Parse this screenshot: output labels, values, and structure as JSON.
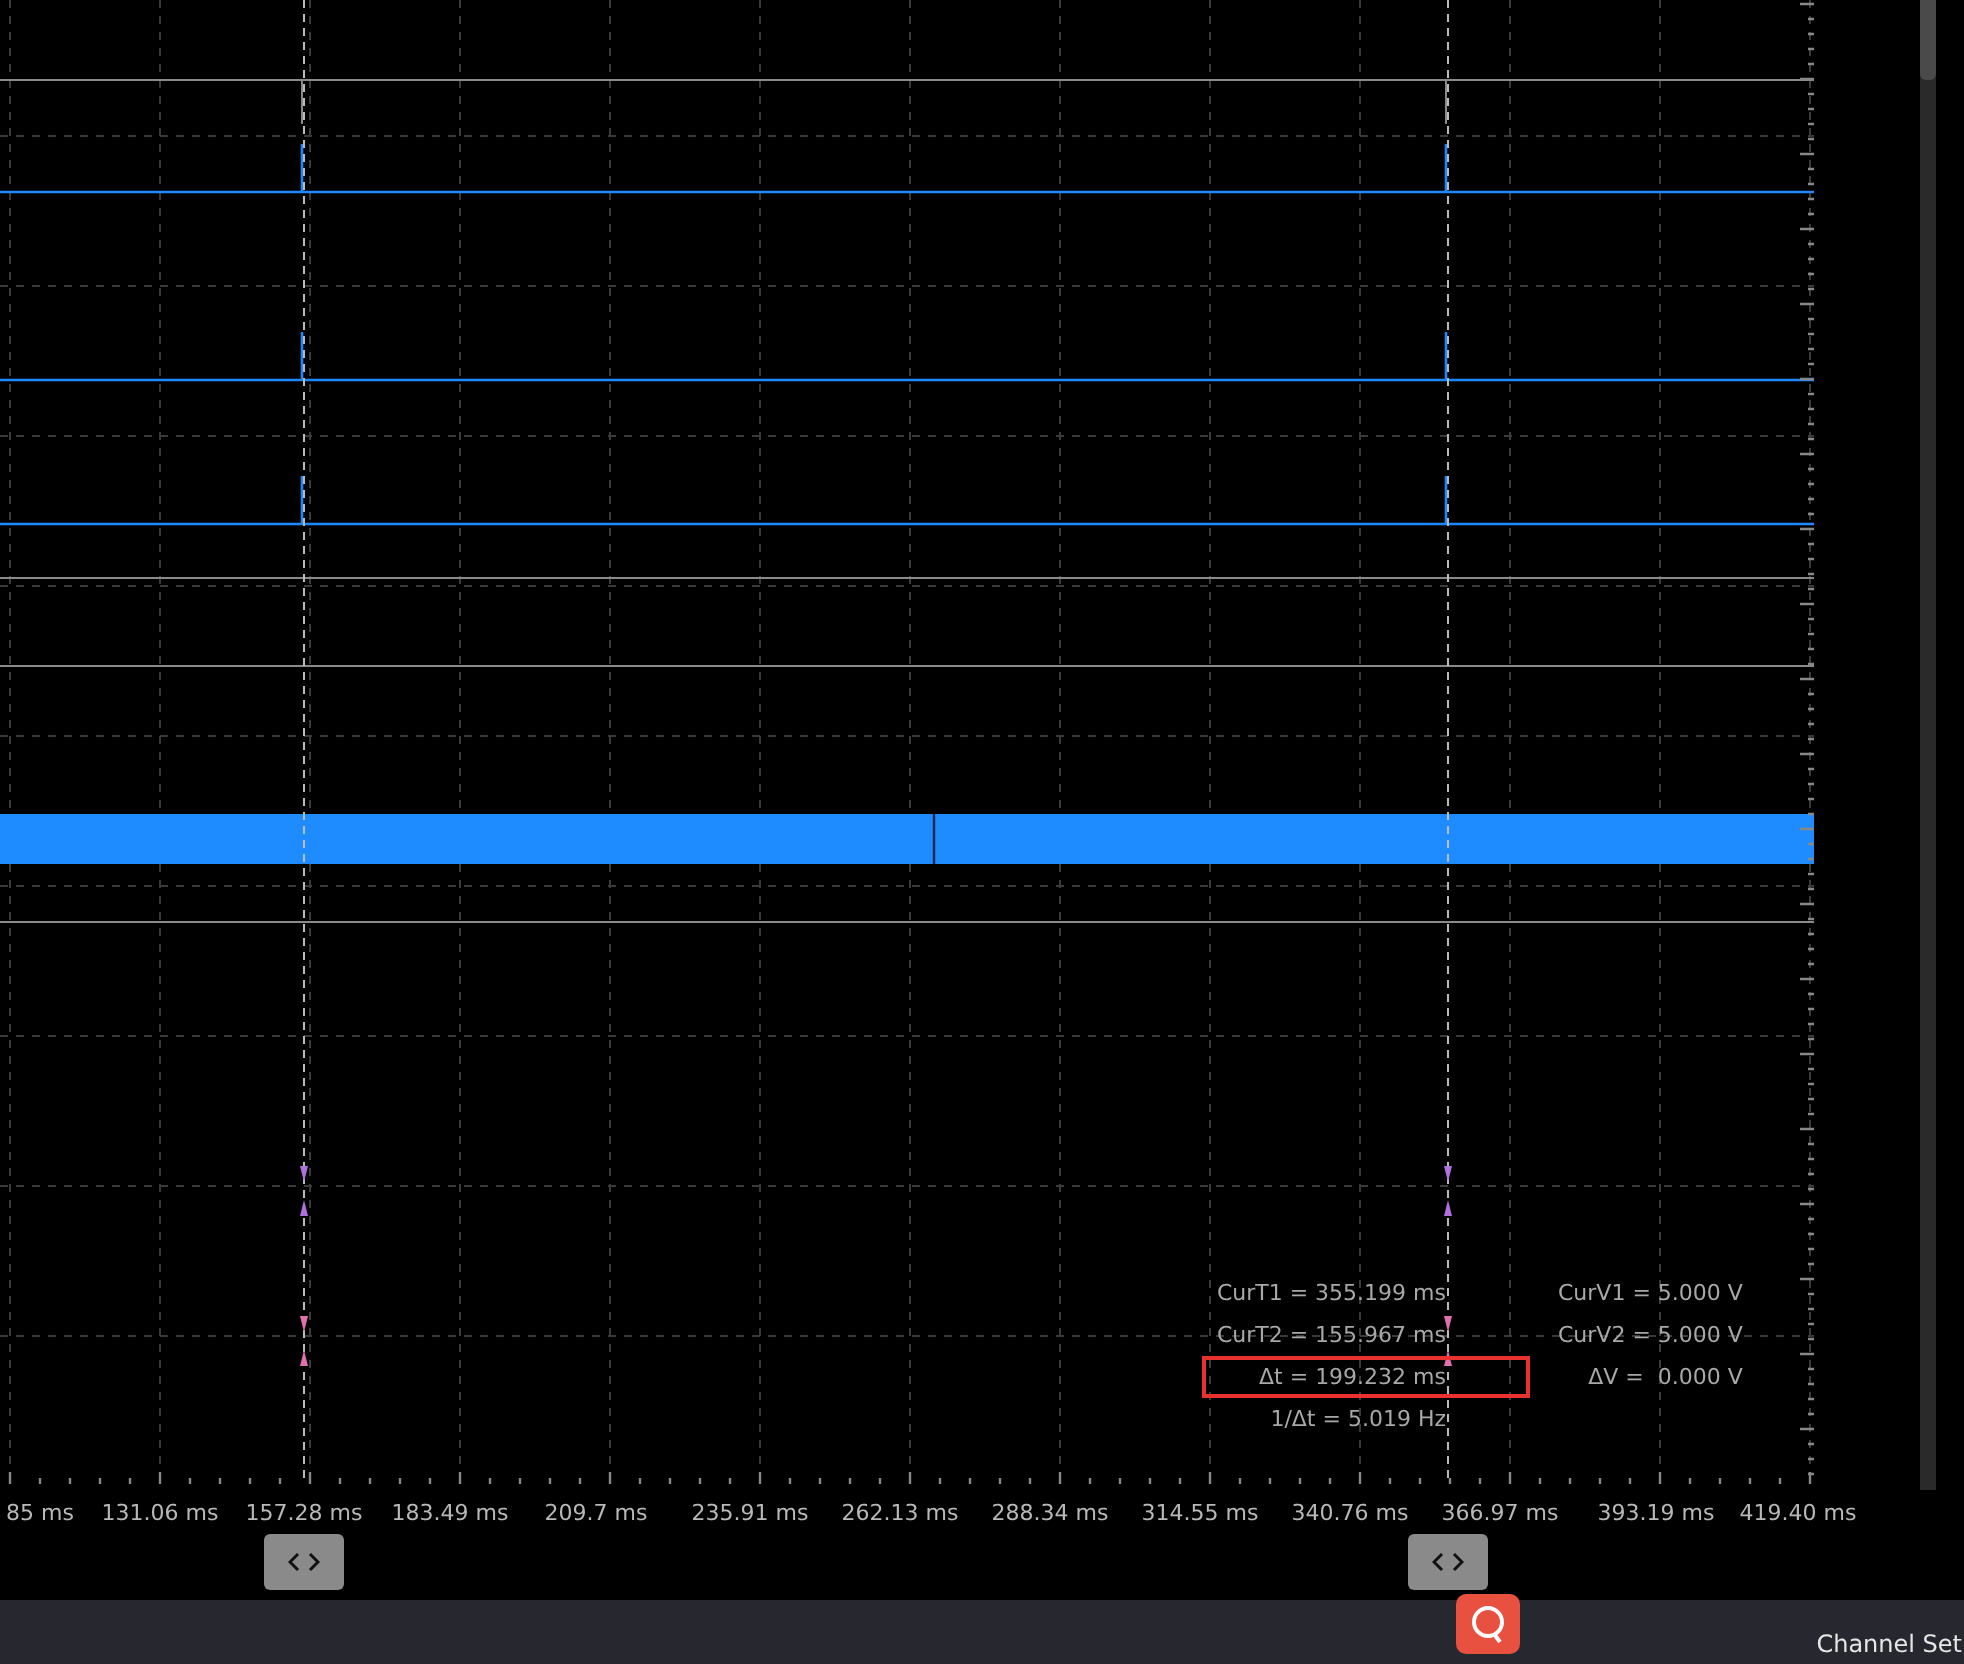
{
  "plot": {
    "x_axis_labels": [
      "85 ms",
      "131.06 ms",
      "157.28 ms",
      "183.49 ms",
      "209.7 ms",
      "235.91 ms",
      "262.13 ms",
      "288.34 ms",
      "314.55 ms",
      "340.76 ms",
      "366.97 ms",
      "393.19 ms",
      "419.40 ms"
    ]
  },
  "readouts": {
    "time": [
      {
        "text": "CurT1 = 355.199 ms",
        "highlighted": false
      },
      {
        "text": "CurT2 = 155.967 ms",
        "highlighted": false
      },
      {
        "text": "Δt = 199.232 ms",
        "highlighted": true
      },
      {
        "text": "1/Δt = 5.019 Hz",
        "highlighted": false
      }
    ],
    "voltage": [
      {
        "text": "CurV1 = 5.000 V"
      },
      {
        "text": "CurV2 = 5.000 V"
      },
      {
        "text": "ΔV =  0.000 V"
      }
    ]
  },
  "bottom_bar": {
    "label": "Channel Set"
  }
}
